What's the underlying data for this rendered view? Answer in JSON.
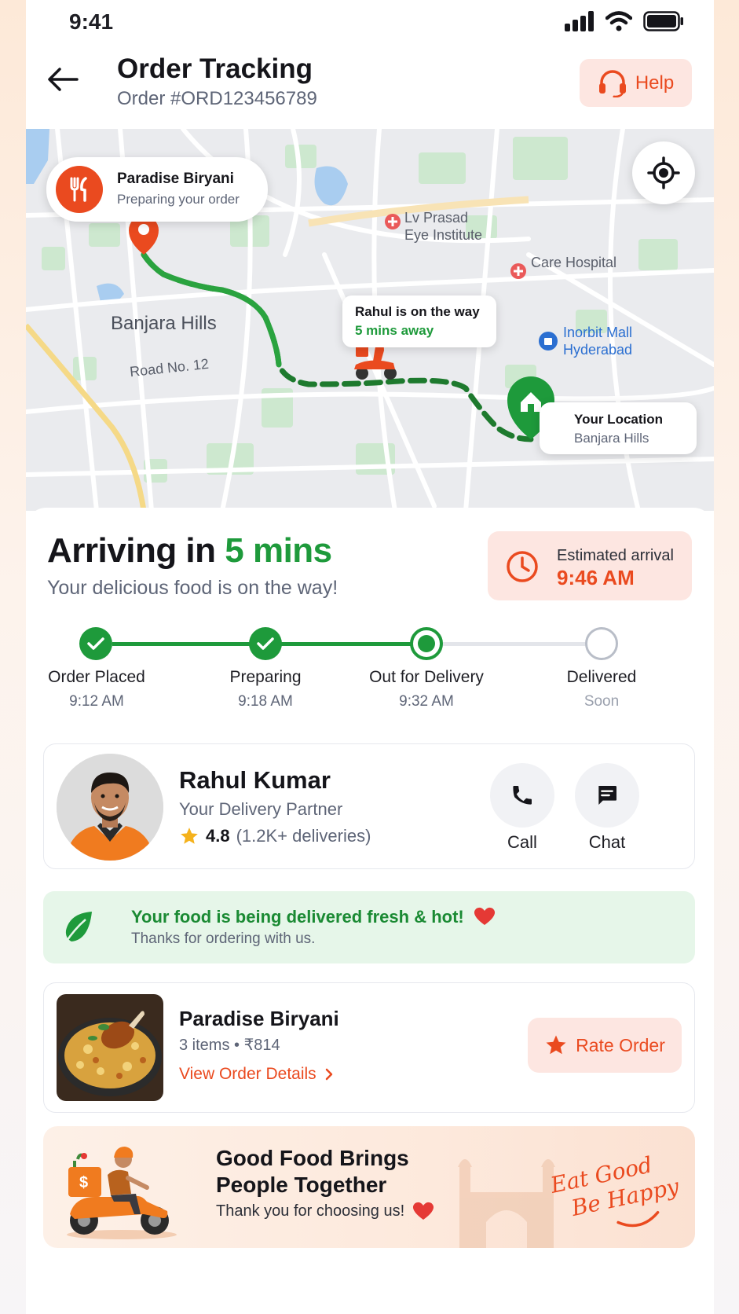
{
  "status_bar": {
    "time": "9:41"
  },
  "header": {
    "title": "Order Tracking",
    "order_id": "Order #ORD123456789",
    "help_label": "Help"
  },
  "map": {
    "restaurant": {
      "name": "Paradise Biryani",
      "status": "Preparing your order"
    },
    "rider": {
      "line1": "Rahul is on the way",
      "line2": "5 mins away"
    },
    "destination": {
      "label": "Your Location",
      "area": "Banjara Hills"
    },
    "places": {
      "lv_prasad_1": "Lv Prasad",
      "lv_prasad_2": "Eye Institute",
      "care_hospital": "Care Hospital",
      "inorbit_1": "Inorbit Mall",
      "inorbit_2": "Hyderabad",
      "banjara": "Banjara Hills",
      "road": "Road No. 12"
    }
  },
  "arrival": {
    "prefix": "Arriving in",
    "eta": "5 mins",
    "subtitle": "Your delicious food is on the way!",
    "estimated_label": "Estimated arrival",
    "estimated_time": "9:46 AM"
  },
  "steps": [
    {
      "label": "Order Placed",
      "time": "9:12 AM",
      "state": "done"
    },
    {
      "label": "Preparing",
      "time": "9:18 AM",
      "state": "done"
    },
    {
      "label": "Out for Delivery",
      "time": "9:32 AM",
      "state": "current"
    },
    {
      "label": "Delivered",
      "time": "Soon",
      "state": "pending"
    }
  ],
  "partner": {
    "name": "Rahul Kumar",
    "role": "Your Delivery Partner",
    "rating": "4.8",
    "deliveries": "(1.2K+ deliveries)",
    "call_label": "Call",
    "chat_label": "Chat"
  },
  "fresh_banner": {
    "title": "Your food is being delivered fresh & hot!",
    "subtitle": "Thanks for ordering with us."
  },
  "order": {
    "restaurant": "Paradise Biryani",
    "meta": "3 items • ₹814",
    "details_link": "View Order Details",
    "rate_label": "Rate Order"
  },
  "promo": {
    "title": "Good Food Brings People Together",
    "subtitle": "Thank you for choosing us!",
    "tagline_1": "Eat Good",
    "tagline_2": "Be Happy"
  },
  "colors": {
    "accent": "#ea4a1f",
    "success": "#1e9a3b",
    "soft_accent_bg": "#fde6e1",
    "soft_success_bg": "#e6f6e9"
  }
}
